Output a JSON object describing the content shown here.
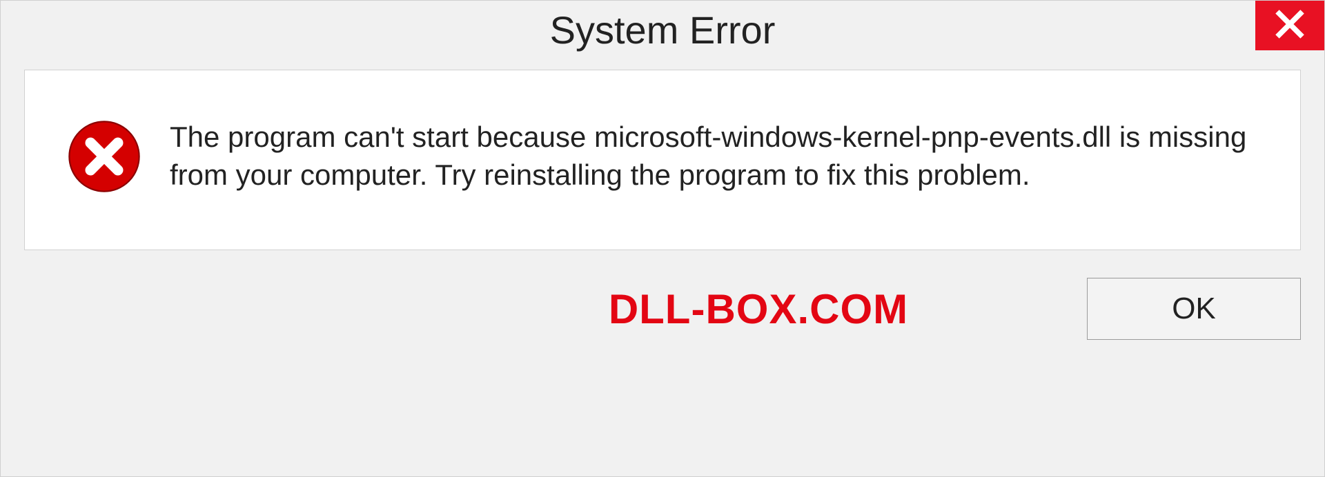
{
  "title": "System Error",
  "message": "The program can't start because microsoft-windows-kernel-pnp-events.dll is missing from your computer. Try reinstalling the program to fix this problem.",
  "ok_label": "OK",
  "watermark": "DLL-BOX.COM",
  "close_color": "#e81123",
  "icon_name": "error-circle-icon"
}
